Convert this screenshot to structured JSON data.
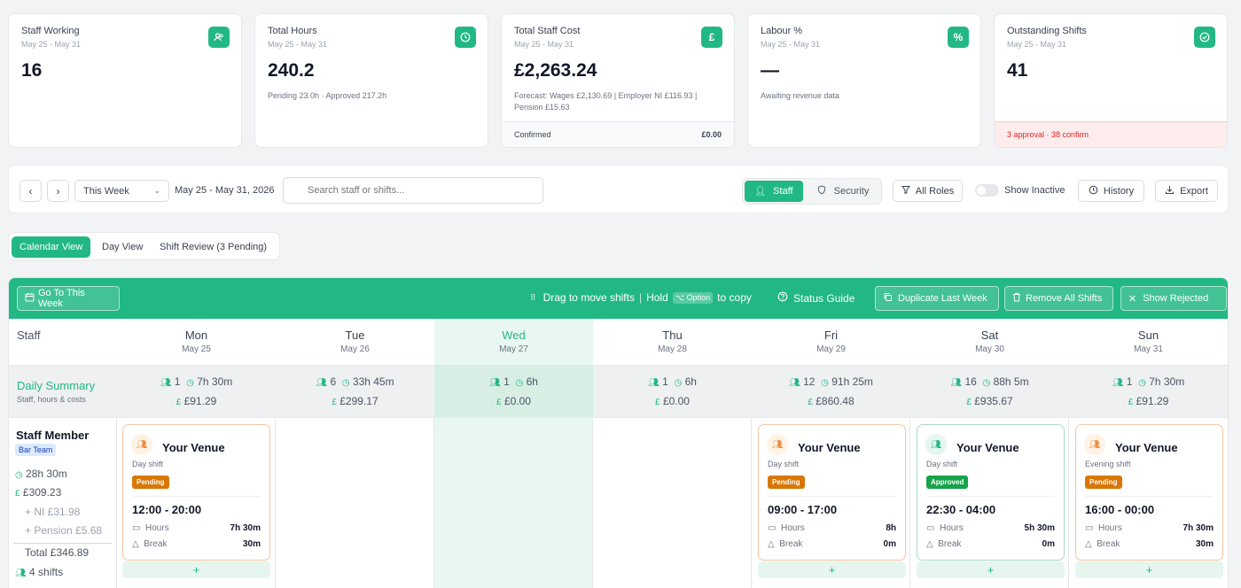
{
  "cards": [
    {
      "title": "Staff Working",
      "sub": "May 25 - May 31",
      "value": "16",
      "icon": "users-icon"
    },
    {
      "title": "Total Hours",
      "sub": "May 25 - May 31",
      "value": "240.2",
      "extra": "Pending 23.0h · Approved 217.2h",
      "icon": "clock-icon"
    },
    {
      "title": "Total Staff Cost",
      "sub": "May 25 - May 31",
      "value": "£2,263.24",
      "extra": "Forecast: Wages £2,130.69 | Employer NI £116.93 | Pension £15.63",
      "footer_label": "Confirmed",
      "footer_value": "£0.00",
      "icon": "pound-icon"
    },
    {
      "title": "Labour %",
      "sub": "May 25 - May 31",
      "value": "—",
      "extra": "Awaiting revenue data",
      "icon": "percent-icon"
    },
    {
      "title": "Outstanding Shifts",
      "sub": "May 25 - May 31",
      "value": "41",
      "footer_label": "3 approval · 38 confirm",
      "icon": "check-circle-icon"
    }
  ],
  "toolbar": {
    "week_select": "This Week",
    "date_range": "May 25 - May 31, 2026",
    "search_placeholder": "Search staff or shifts...",
    "staff_tab": "Staff",
    "security_tab": "Security",
    "roles": "All Roles",
    "show_inactive": "Show Inactive",
    "history": "History",
    "export": "Export"
  },
  "views": {
    "calendar": "Calendar View",
    "day": "Day View",
    "review": "Shift Review (3 Pending)"
  },
  "calbar": {
    "goto": "Go To This Week",
    "drag": "Drag to move shifts",
    "hold": "Hold",
    "option": "⌥ Option",
    "copy": "to copy",
    "status": "Status Guide",
    "dup": "Duplicate Last Week",
    "remove": "Remove All Shifts",
    "rejected": "Show Rejected"
  },
  "grid": {
    "staff_header": "Staff",
    "summary_title": "Daily Summary",
    "summary_sub": "Staff, hours & costs"
  },
  "days": [
    {
      "name": "Mon",
      "date": "May 25",
      "staff": "1",
      "hours": "7h 30m",
      "cost": "£91.29"
    },
    {
      "name": "Tue",
      "date": "May 26",
      "staff": "6",
      "hours": "33h 45m",
      "cost": "£299.17"
    },
    {
      "name": "Wed",
      "date": "May 27",
      "staff": "1",
      "hours": "6h",
      "cost": "£0.00"
    },
    {
      "name": "Thu",
      "date": "May 28",
      "staff": "1",
      "hours": "6h",
      "cost": "£0.00"
    },
    {
      "name": "Fri",
      "date": "May 29",
      "staff": "12",
      "hours": "91h 25m",
      "cost": "£860.48"
    },
    {
      "name": "Sat",
      "date": "May 30",
      "staff": "16",
      "hours": "88h 5m",
      "cost": "£935.67"
    },
    {
      "name": "Sun",
      "date": "May 31",
      "staff": "1",
      "hours": "7h 30m",
      "cost": "£91.29"
    }
  ],
  "member": {
    "name": "Staff Member",
    "team": "Bar Team",
    "hours": "28h 30m",
    "wage": "£309.23",
    "ni": "+ NI £31.98",
    "pension": "+ Pension £5.68",
    "total": "Total £346.89",
    "shifts": "4 shifts"
  },
  "shifts": [
    {
      "venue": "Your Venue",
      "type": "Day shift",
      "status": "Pending",
      "time": "12:00 - 20:00",
      "hours_label": "Hours",
      "hours": "7h 30m",
      "break_label": "Break",
      "break": "30m"
    },
    {
      "venue": "Your Venue",
      "type": "Day shift",
      "status": "Pending",
      "time": "09:00 - 17:00",
      "hours_label": "Hours",
      "hours": "8h",
      "break_label": "Break",
      "break": "0m"
    },
    {
      "venue": "Your Venue",
      "type": "Day shift",
      "status": "Approved",
      "time": "22:30 - 04:00",
      "hours_label": "Hours",
      "hours": "5h 30m",
      "break_label": "Break",
      "break": "0m"
    },
    {
      "venue": "Your Venue",
      "type": "Evening shift",
      "status": "Pending",
      "time": "16:00 - 00:00",
      "hours_label": "Hours",
      "hours": "7h 30m",
      "break_label": "Break",
      "break": "30m"
    }
  ],
  "add_label": "+",
  "colors": {
    "accent": "#22b883",
    "pending": "#d97706",
    "approved": "#16a34a"
  }
}
